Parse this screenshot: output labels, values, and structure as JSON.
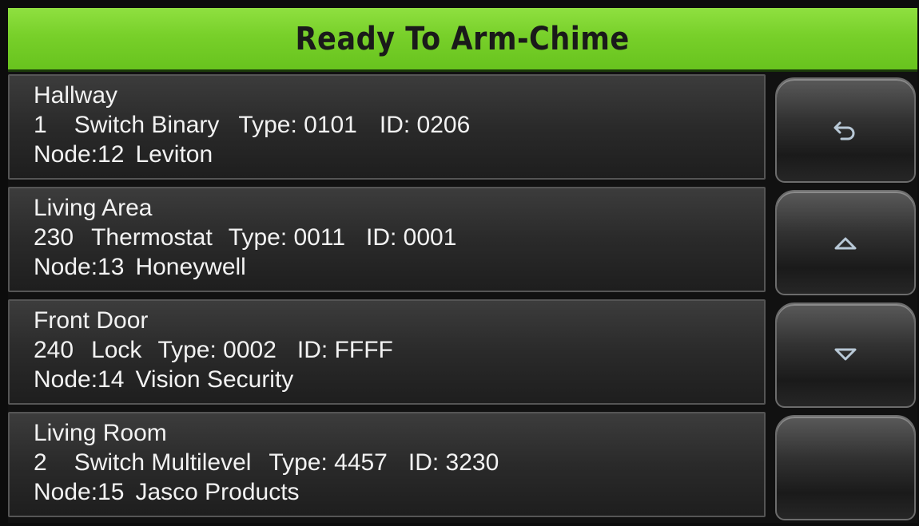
{
  "header": {
    "title": "Ready To Arm-Chime"
  },
  "devices": [
    {
      "name": "Hallway",
      "number": "1",
      "type_name": "Switch Binary",
      "type": "Type: 0101",
      "id": "ID: 0206",
      "node": "Node:12",
      "manufacturer": "Leviton"
    },
    {
      "name": "Living Area",
      "number": "230",
      "type_name": "Thermostat",
      "type": "Type: 0011",
      "id": "ID: 0001",
      "node": "Node:13",
      "manufacturer": "Honeywell"
    },
    {
      "name": "Front Door",
      "number": "240",
      "type_name": "Lock",
      "type": "Type: 0002",
      "id": "ID: FFFF",
      "node": "Node:14",
      "manufacturer": "Vision Security"
    },
    {
      "name": "Living Room",
      "number": "2",
      "type_name": "Switch Multilevel",
      "type": "Type: 4457",
      "id": "ID: 3230",
      "node": "Node:15",
      "manufacturer": "Jasco Products"
    }
  ],
  "sidebar": {
    "buttons": [
      {
        "icon": "back-arrow-icon"
      },
      {
        "icon": "scroll-up-icon"
      },
      {
        "icon": "scroll-down-icon"
      },
      {
        "icon": "blank"
      }
    ]
  },
  "colors": {
    "header_bg": "#78d02a",
    "row_bg": "#2a2a2a",
    "text": "#f2f2f2"
  }
}
